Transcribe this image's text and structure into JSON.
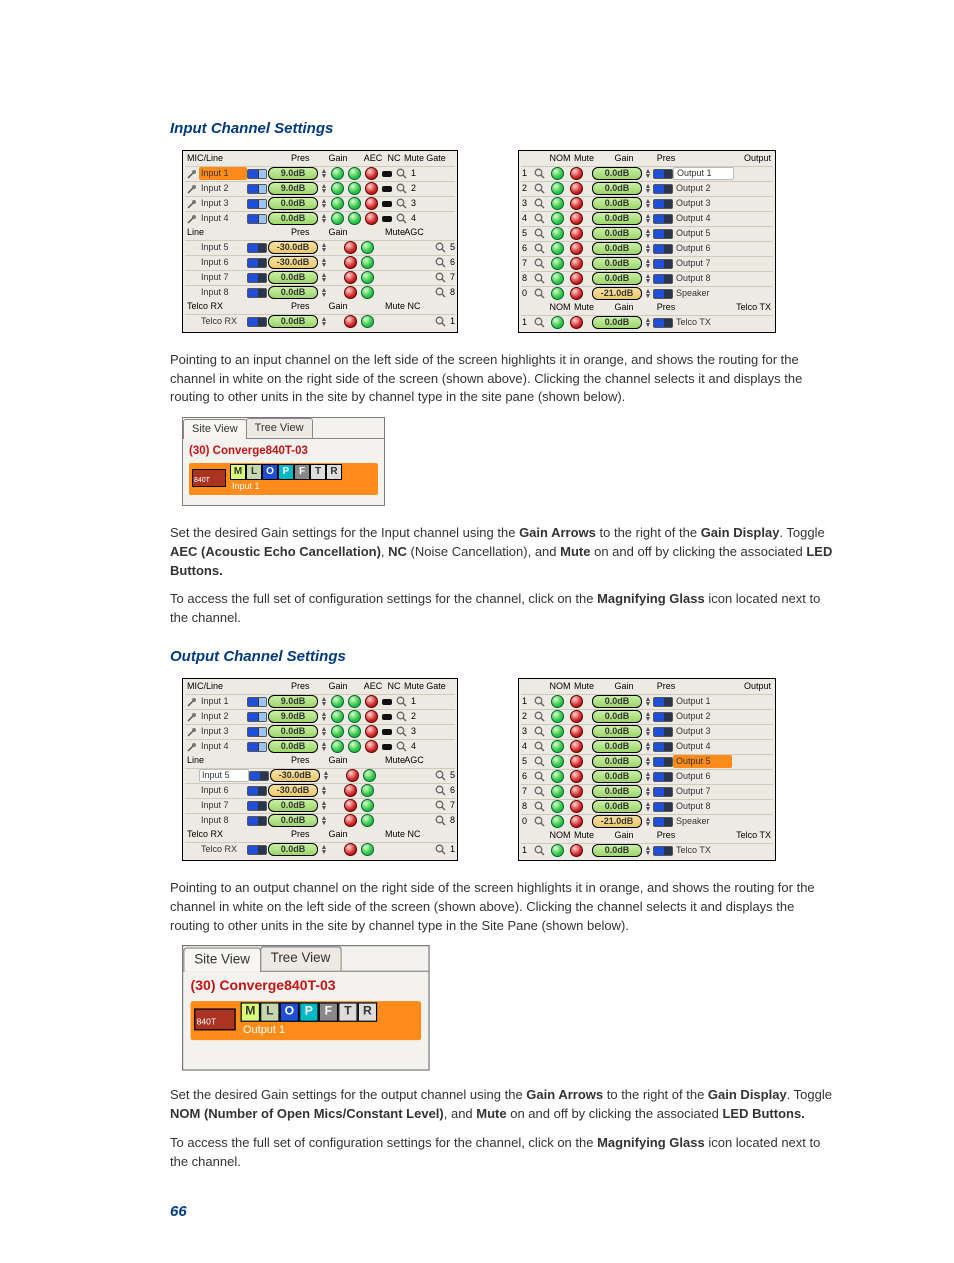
{
  "headings": {
    "input": "Input Channel Settings",
    "output": "Output Channel Settings"
  },
  "page_number": "66",
  "left_headers": {
    "micline": "MIC/Line",
    "line": "Line",
    "telco": "Telco RX",
    "pres": "Pres",
    "gain": "Gain",
    "aec": "AEC",
    "nc": "NC",
    "mute": "Mute",
    "gate": "Gate",
    "agc": "AGC"
  },
  "right_headers": {
    "nom": "NOM",
    "mute": "Mute",
    "gain": "Gain",
    "pres": "Pres",
    "output": "Output",
    "telco": "Telco TX"
  },
  "mic_rows": [
    {
      "label": "Input 1",
      "gain": "9.0dB"
    },
    {
      "label": "Input 2",
      "gain": "9.0dB"
    },
    {
      "label": "Input 3",
      "gain": "0.0dB"
    },
    {
      "label": "Input 4",
      "gain": "0.0dB"
    }
  ],
  "line_rows": [
    {
      "label": "Input 5",
      "gain": "-30.0dB"
    },
    {
      "label": "Input 6",
      "gain": "-30.0dB"
    },
    {
      "label": "Input 7",
      "gain": "0.0dB"
    },
    {
      "label": "Input 8",
      "gain": "0.0dB"
    }
  ],
  "telco_rx": {
    "label": "Telco RX",
    "gain": "0.0dB"
  },
  "out_rows": [
    {
      "n": "1",
      "label": "Output 1",
      "gain": "0.0dB"
    },
    {
      "n": "2",
      "label": "Output 2",
      "gain": "0.0dB"
    },
    {
      "n": "3",
      "label": "Output 3",
      "gain": "0.0dB"
    },
    {
      "n": "4",
      "label": "Output 4",
      "gain": "0.0dB"
    },
    {
      "n": "5",
      "label": "Output 5",
      "gain": "0.0dB"
    },
    {
      "n": "6",
      "label": "Output 6",
      "gain": "0.0dB"
    },
    {
      "n": "7",
      "label": "Output 7",
      "gain": "0.0dB"
    },
    {
      "n": "8",
      "label": "Output 8",
      "gain": "0.0dB"
    },
    {
      "n": "0",
      "label": "Speaker",
      "gain": "-21.0dB"
    }
  ],
  "telco_tx": {
    "n": "1",
    "label": "Telco TX",
    "gain": "0.0dB"
  },
  "siteview": {
    "tabs": {
      "site": "Site View",
      "tree": "Tree View"
    },
    "device": "(30) Converge840T-03",
    "unit": "840T",
    "badges": [
      "M",
      "L",
      "O",
      "P",
      "F",
      "T",
      "R"
    ],
    "ch_input": "Input 1",
    "ch_output": "Output 1"
  },
  "para": {
    "p1a": "Pointing to an input channel on the left side of the screen highlights it in orange, and shows the routing for the channel in white on the right side of the screen (shown above). Clicking the channel selects it and displays the routing to other units in the site by channel type in the site pane (shown below).",
    "p2a": "Set the desired Gain settings for the Input channel using the ",
    "p2b": "Gain Arrows",
    "p2c": " to the right of the ",
    "p2d": "Gain Display",
    "p2e": ". Toggle ",
    "p2f": "AEC (Acoustic Echo Cancellation)",
    "p2g": ", ",
    "p2h": "NC",
    "p2i": " (Noise Cancellation), and ",
    "p2j": "Mute",
    "p2k": " on and off by clicking the associated ",
    "p2l": "LED Buttons.",
    "p3a": "To access the full set of configuration settings for the channel, click on the ",
    "p3b": "Magnifying Glass",
    "p3c": " icon located next to the channel.",
    "p4a": "Pointing to an output channel on the right side of the screen highlights it in orange, and shows the routing for the channel in white on the left side of the screen (shown above). Clicking the channel selects it and displays the routing to other units in the site by channel type in the Site Pane (shown below).",
    "p5a": "Set the desired Gain settings for the output channel using the ",
    "p5b": "Gain Arrows",
    "p5c": " to the right of the ",
    "p5d": "Gain Display",
    "p5e": ". Toggle ",
    "p5f": "NOM (Number of Open Mics/Constant Level)",
    "p5g": ", and ",
    "p5h": "Mute",
    "p5i": " on and off by clicking the associated ",
    "p5j": "LED Buttons."
  }
}
